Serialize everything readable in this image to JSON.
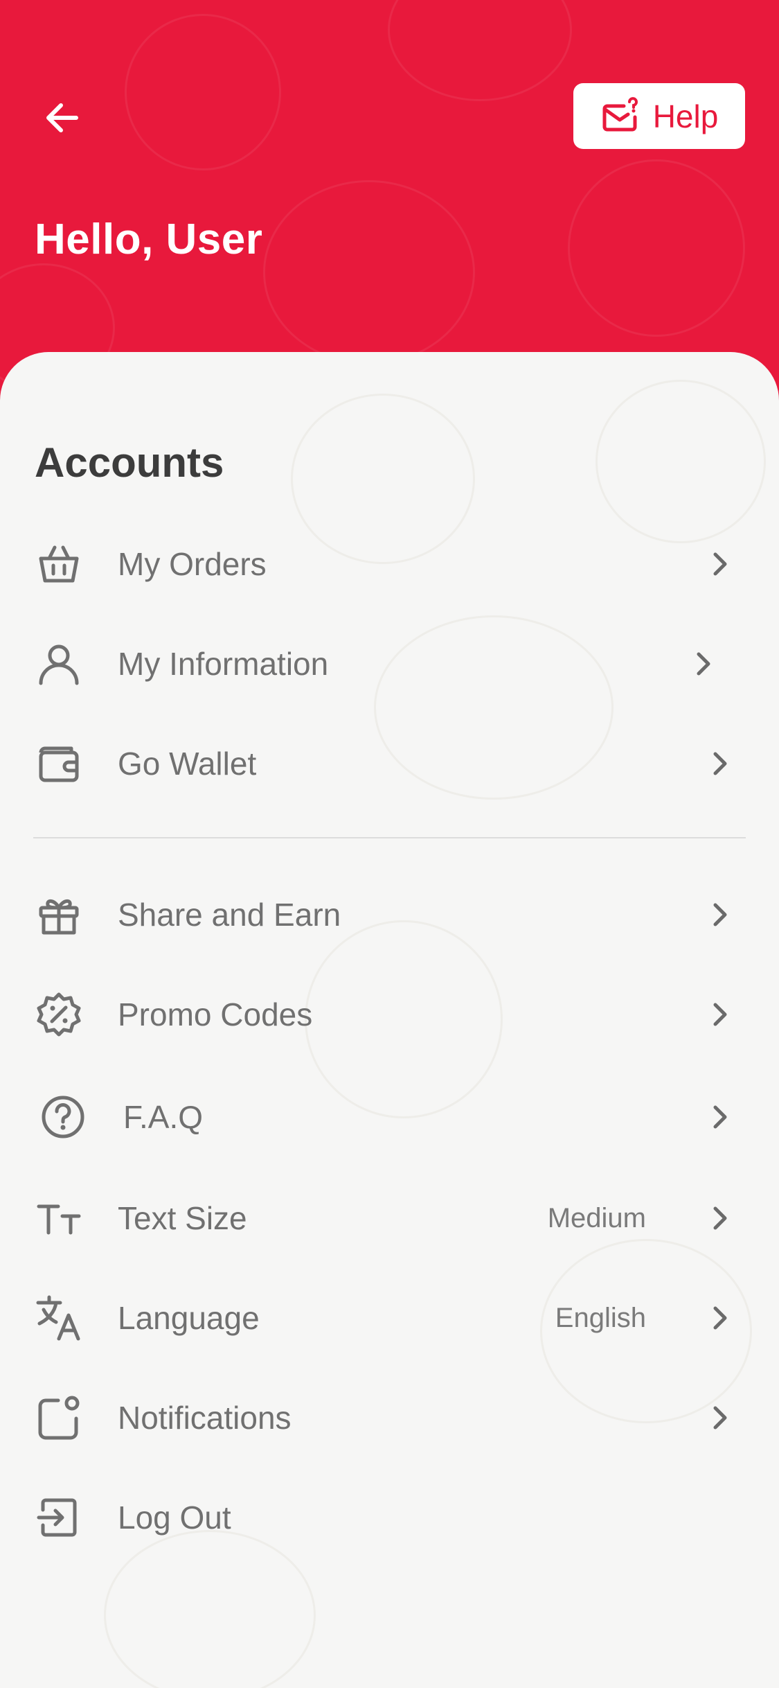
{
  "colors": {
    "brand": "#e8193c",
    "sheet_background": "#f6f6f5",
    "text_muted": "#707070",
    "heading": "#3c3c3c"
  },
  "header": {
    "back_icon": "arrow-left-icon",
    "help_label": "Help",
    "help_icon": "mail-question-icon",
    "greeting": "Hello, User"
  },
  "accounts": {
    "title": "Accounts",
    "items": [
      {
        "label": "My Orders",
        "icon": "basket-icon"
      },
      {
        "label": "My Information",
        "icon": "user-icon"
      },
      {
        "label": "Go Wallet",
        "icon": "wallet-icon"
      }
    ]
  },
  "settings": {
    "items": [
      {
        "label": "Share and Earn",
        "icon": "gift-icon"
      },
      {
        "label": "Promo Codes",
        "icon": "discount-badge-icon"
      },
      {
        "label": "F.A.Q",
        "icon": "question-circle-icon"
      },
      {
        "label": "Text Size",
        "icon": "text-size-icon",
        "value": "Medium"
      },
      {
        "label": "Language",
        "icon": "translate-icon",
        "value": "English"
      },
      {
        "label": "Notifications",
        "icon": "notification-icon"
      },
      {
        "label": "Log Out",
        "icon": "logout-icon"
      }
    ]
  }
}
